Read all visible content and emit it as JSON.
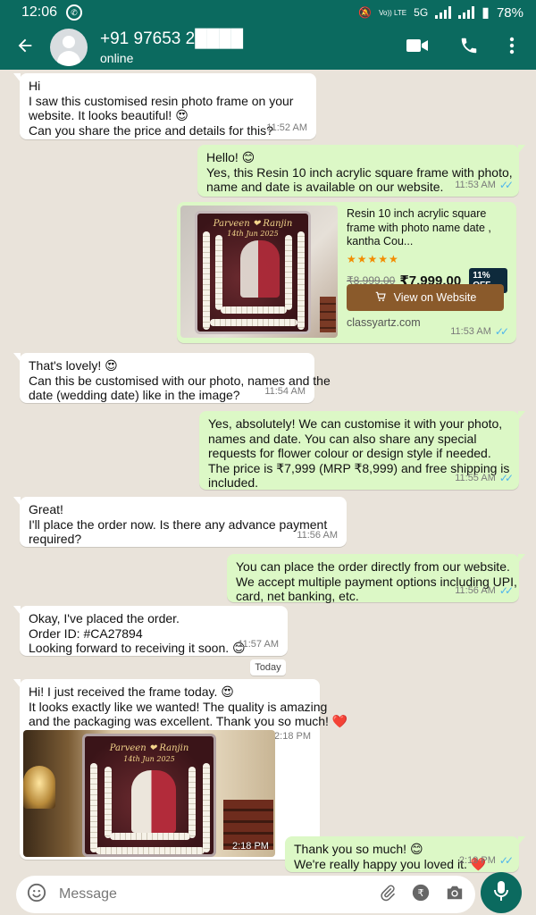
{
  "status_bar": {
    "time": "12:06",
    "network_a": "Vo)) LTE",
    "network_b": "5G",
    "battery": "78%"
  },
  "header": {
    "contact_name": "+91 97653 2████",
    "status": "online"
  },
  "messages": [
    {
      "dir": "in",
      "lines": [
        "Hi",
        "I saw this customised resin photo frame on your",
        "website. It looks beautiful! 😍",
        "Can you share the price and details for this?"
      ],
      "time": "11:52 AM"
    },
    {
      "dir": "out",
      "lines": [
        "Hello! 😊",
        "Yes, this Resin 10 inch acrylic square frame with photo,",
        "name and date is available on our website."
      ],
      "time": "11:53 AM"
    },
    {
      "dir": "in",
      "lines": [
        "That's lovely! 😍",
        "Can this be customised with our photo, names and the",
        "date (wedding date) like in the image?"
      ],
      "time": "11:54 AM"
    },
    {
      "dir": "out",
      "lines": [
        "Yes, absolutely!  We can customise it with your photo,",
        "names and date. You can also share any special",
        "requests for flower colour or design style if needed.",
        "The price is ₹7,999 (MRP ₹8,999) and free shipping is",
        "included."
      ],
      "time": "11:55 AM"
    },
    {
      "dir": "in",
      "lines": [
        "Great!",
        "I'll place the order now. Is there any advance payment",
        "required?"
      ],
      "time": "11:56 AM"
    },
    {
      "dir": "out",
      "lines": [
        "You can place the order directly from our website.",
        "We accept multiple payment options including UPI,",
        "card, net banking, etc."
      ],
      "time": "11:56 AM"
    },
    {
      "dir": "in",
      "lines": [
        "Okay, I've placed the order.",
        "Order ID: #CA27894",
        "Looking forward to receiving it soon. 😊"
      ],
      "time": "11:57 AM"
    },
    {
      "dir": "in",
      "lines": [
        "Hi! I just received the frame today. 😍",
        "It looks exactly like we wanted! The quality is amazing",
        "and the packaging was excellent. Thank you so much! ❤️"
      ],
      "time": "2:18 PM"
    },
    {
      "dir": "out",
      "lines": [
        "Thank you so much! 😊",
        "We're really happy you loved it. ❤️"
      ],
      "time": "2:19 PM"
    }
  ],
  "product_card": {
    "frame_title": "Parveen ❤ Ranjin",
    "frame_date": "14th Jun 2025",
    "title_lines": [
      "Resin 10 inch acrylic square",
      "frame with photo name date ,",
      "kantha Cou..."
    ],
    "stars": "★★★★★",
    "mrp": "₹8,999.00",
    "price": "₹7,999.00",
    "discount": "11% OFF",
    "button_label": "View on Website",
    "domain": "classyartz.com",
    "time": "11:53 AM"
  },
  "date_divider": "Today",
  "received_image": {
    "frame_title": "Parveen ❤ Ranjin",
    "frame_date": "14th Jun 2025",
    "time": "2:18 PM"
  },
  "composer": {
    "placeholder": "Message"
  },
  "colors": {
    "header": "#0b6a5f",
    "outgoing": "#dcf8c6",
    "incoming": "#ffffff",
    "background": "#e9e3da",
    "read_ticks": "#4fb6ec"
  }
}
